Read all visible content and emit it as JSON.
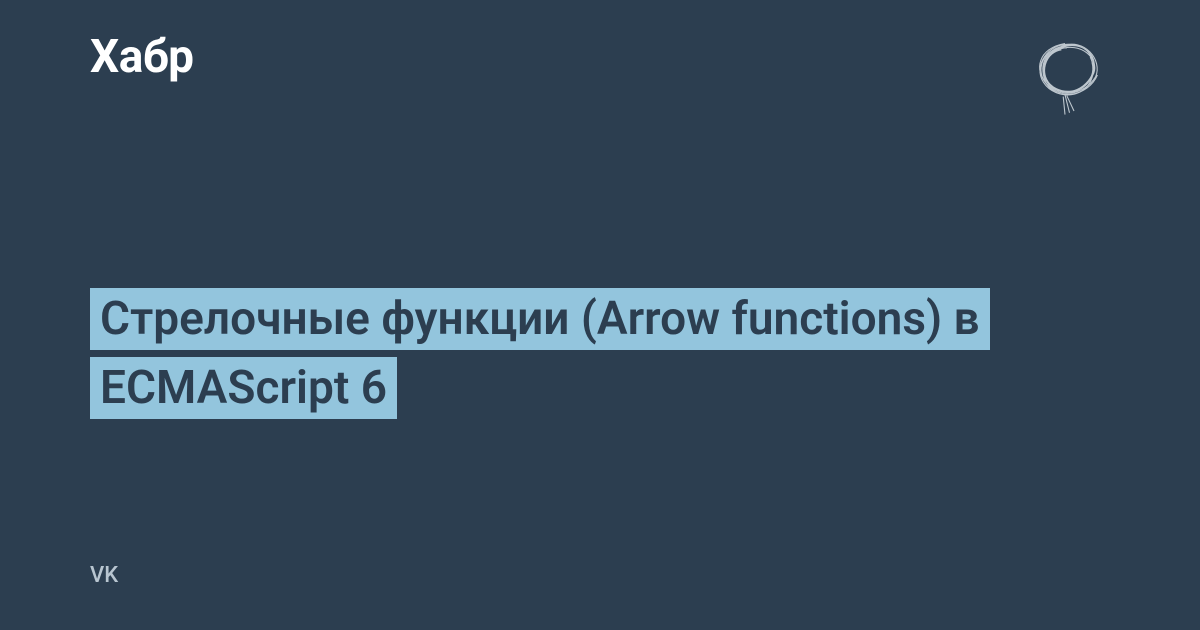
{
  "header": {
    "logo": "Хабр"
  },
  "main": {
    "title": "Стрелочные функции (Arrow functions) в ECMAScript 6"
  },
  "footer": {
    "author": "VK"
  },
  "icons": {
    "scribble": "scribble-icon"
  },
  "colors": {
    "background": "#2c3e50",
    "highlight": "#93c5dd",
    "text_light": "#ffffff",
    "text_muted": "#b8c5d0"
  }
}
